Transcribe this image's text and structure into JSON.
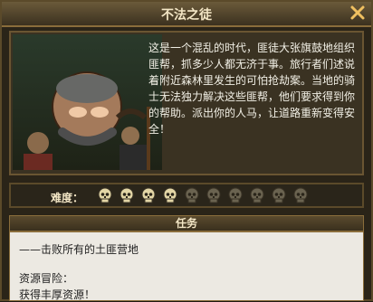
{
  "window": {
    "title": "不法之徒"
  },
  "panel": {
    "story": "这是一个混乱的时代，匪徒大张旗鼓地组织匪帮，抓多少人都无济于事。旅行者们述说着附近森林里发生的可怕抢劫案。当地的骑士无法独力解决这些匪帮，他们要求得到你的帮助。派出你的人马，让道路重新变得安全！"
  },
  "difficulty": {
    "label": "难度：",
    "level": 4,
    "max": 10
  },
  "task": {
    "title": "任务",
    "line1": "——击败所有的土匪营地",
    "line2": "资源冒险：",
    "line3": "获得丰厚资源！"
  },
  "colors": {
    "skull_active": "#e3d6a6",
    "skull_inactive": "#6a6350"
  }
}
